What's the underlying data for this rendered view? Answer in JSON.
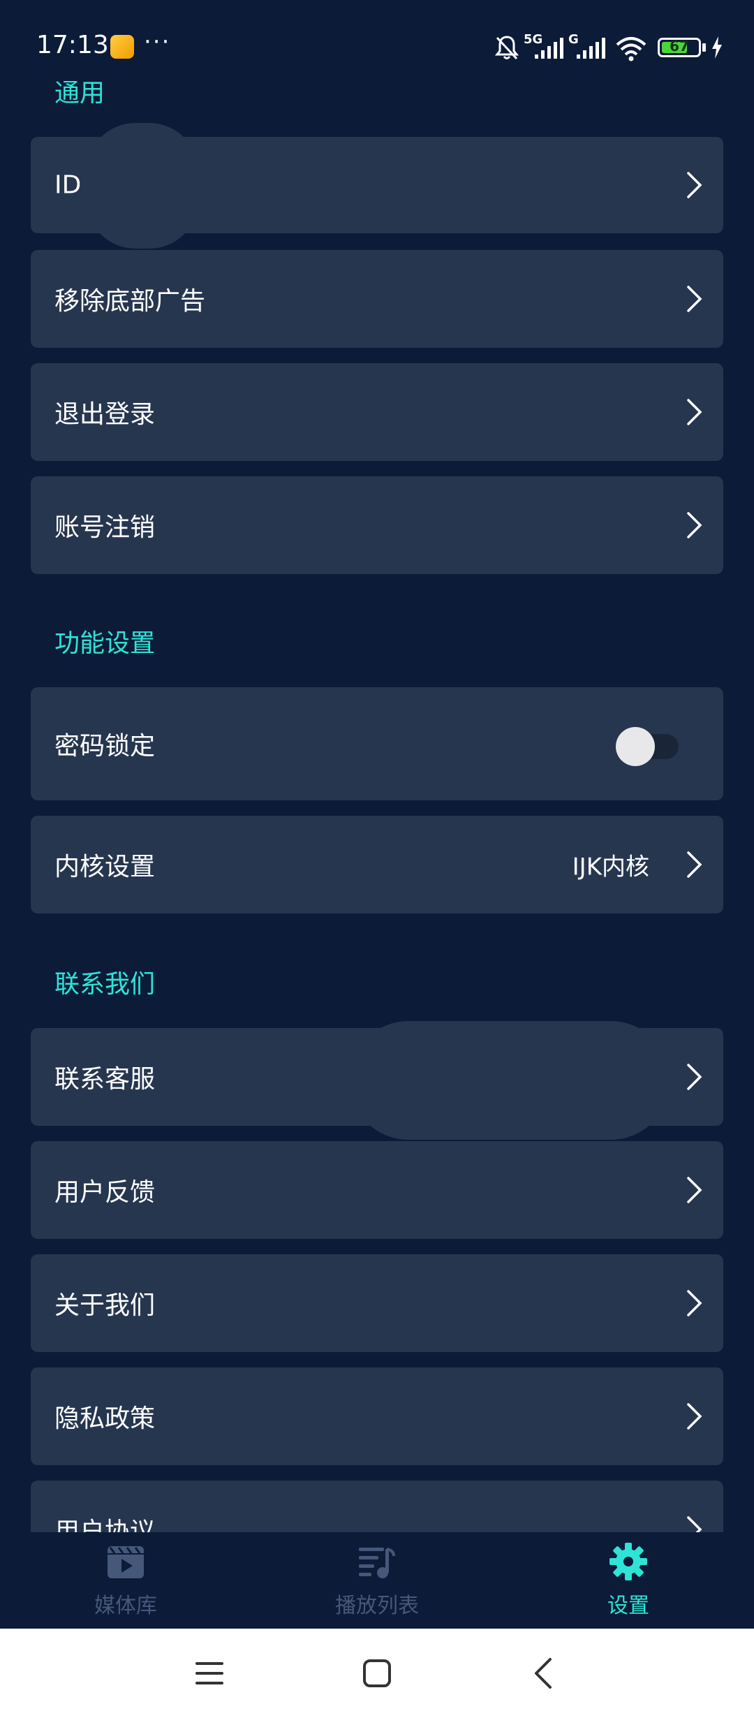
{
  "status_bar": {
    "time": "17:13",
    "dots": "···",
    "network_5g": "5G",
    "network_g": "G",
    "battery_level": "67"
  },
  "sections": {
    "general": {
      "title": "通用",
      "items": [
        {
          "label": "ID          )(VIP)"
        },
        {
          "label": "移除底部广告"
        },
        {
          "label": "退出登录"
        },
        {
          "label": "账号注销"
        }
      ]
    },
    "features": {
      "title": "功能设置",
      "items": [
        {
          "label": "密码锁定",
          "toggle_on": false
        },
        {
          "label": "内核设置",
          "value": "IJK内核"
        }
      ]
    },
    "contact": {
      "title": "联系我们",
      "items": [
        {
          "label": "联系客服"
        },
        {
          "label": "用户反馈"
        },
        {
          "label": "关于我们"
        },
        {
          "label": "隐私政策"
        },
        {
          "label": "用户协议"
        }
      ]
    }
  },
  "bottom_nav": {
    "items": [
      {
        "label": "媒体库",
        "icon": "video-library-icon"
      },
      {
        "label": "播放列表",
        "icon": "playlist-icon"
      },
      {
        "label": "设置",
        "icon": "gear-icon",
        "active": true
      }
    ]
  },
  "colors": {
    "background": "#0b1b38",
    "card": "#27364f",
    "accent": "#2fe3d6",
    "nav_inactive": "#46587a"
  }
}
